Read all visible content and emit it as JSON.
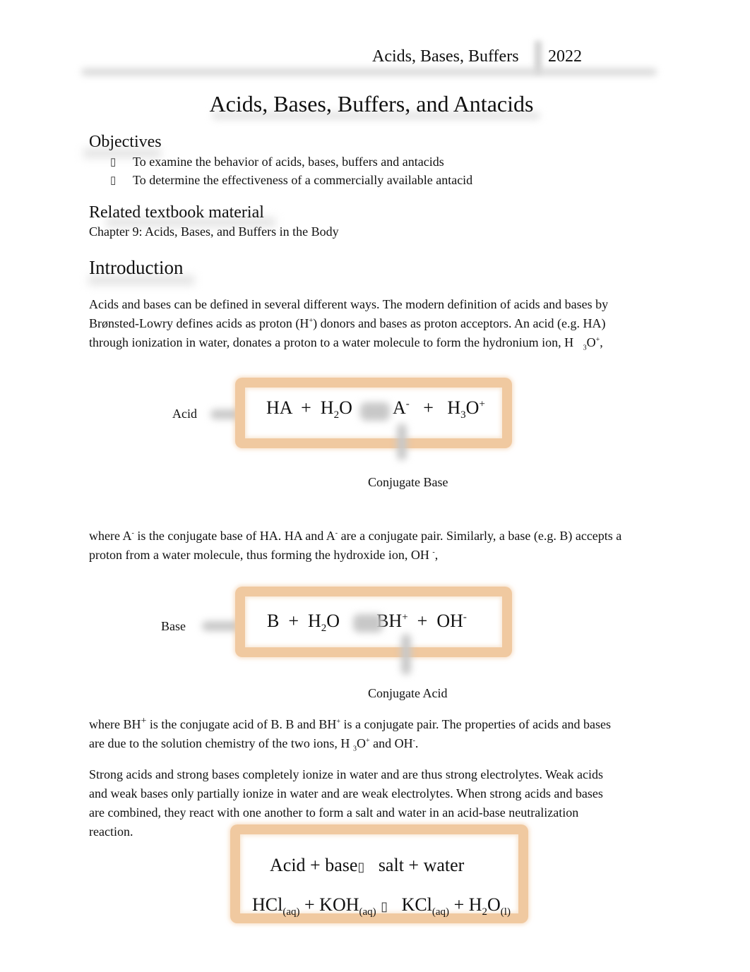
{
  "header": {
    "running_title": "Acids, Bases, Buffers",
    "year": "2022"
  },
  "document": {
    "title": "Acids, Bases, Buffers, and Antacids"
  },
  "objectives": {
    "heading": "Objectives",
    "bullet_icon": "square-bullet-icon",
    "items": [
      "To examine the behavior of acids, bases, buffers and antacids",
      "To determine the effectiveness of a commercially available antacid"
    ]
  },
  "textbook": {
    "heading": "Related textbook material",
    "reference": "Chapter 9: Acids, Bases, and Buffers in the Body"
  },
  "introduction": {
    "heading": "Introduction",
    "p1_line1": "Acids and bases can be defined in several different ways.  The modern definition of acids and bases by",
    "p1_line2a": "Brønsted-Lowry defines acids as proton (H",
    "p1_line2_sup": "+",
    "p1_line2b": ") donors and bases as proton acceptors.    An acid (e.g. HA)",
    "p1_line3a": "through ionization in water, donates a proton to a water molecule to form the hydronium ion, H",
    "p1_line3_sub": "3",
    "p1_line3b": "O",
    "p1_line3_sup": "+",
    "p1_line3c": ",",
    "p2_line1a": "where A",
    "p2_line1_sup1": "-",
    "p2_line1b": " is the conjugate base of HA.  HA and A",
    "p2_line1_sup2": "-",
    "p2_line1c": " are a conjugate pair.   Similarly, a base (e.g. B) accepts a",
    "p2_line2a": "proton from a water molecule, thus forming the hydroxide ion, OH",
    "p2_line2_sup": "-",
    "p2_line2b": ",",
    "p3_line1a": "where BH",
    "p3_line1_sup1": "+",
    "p3_line1b": " is the conjugate acid of B.   B and BH",
    "p3_line1_sup2": "+",
    "p3_line1c": " is a conjugate pair.   The properties of acids and bases",
    "p3_line2a": "are due to the solution chemistry of the two ions, H",
    "p3_line2_sub": "3",
    "p3_line2b": "O",
    "p3_line2_sup1": "+",
    "p3_line2c": " and OH",
    "p3_line2_sup2": "-",
    "p3_line2d": ".",
    "p4_lines": [
      "Strong acids and strong bases  completely ionize in water and are thus strong electrolytes.    Weak acids",
      "and weak bases  only partially ionize in water and are weak electrolytes.   When strong acids and bases",
      "are combined, they react with one another to form a salt and water in an acid-base neutralization",
      "reaction."
    ]
  },
  "equation_acid": {
    "side_label": "Acid",
    "reactant1": "HA",
    "plus": "+",
    "water_h": "H",
    "water_sub": "2",
    "water_o": "O",
    "product1": "A",
    "product1_sup": "-",
    "product2_h": "H",
    "product2_sub": "3",
    "product2_o": "O",
    "product2_sup": "+",
    "annotation": "Conjugate Base"
  },
  "equation_base": {
    "side_label": "Base",
    "reactant1": "B",
    "plus": "+",
    "water_h": "H",
    "water_sub": "2",
    "water_o": "O",
    "product1": "BH",
    "product1_sup": "+",
    "product2": "OH",
    "product2_sup": "-",
    "annotation": "Conjugate Acid"
  },
  "equation_neutralization": {
    "word_left": "Acid + base",
    "arrow_icon": "reaction-arrow-icon",
    "arrow_glyph": "▯",
    "word_right": "salt + water",
    "r1": "HCl",
    "r1_state": "(aq)",
    "r2": "+ KOH",
    "r2_state": "(aq)",
    "p1": "KCl",
    "p1_state": "(aq)",
    "p2_h": "+ H",
    "p2_sub": "2",
    "p2_o": "O",
    "p2_state": "(l)"
  },
  "colors": {
    "box_border": "#f0c9a0",
    "text": "#111111"
  }
}
